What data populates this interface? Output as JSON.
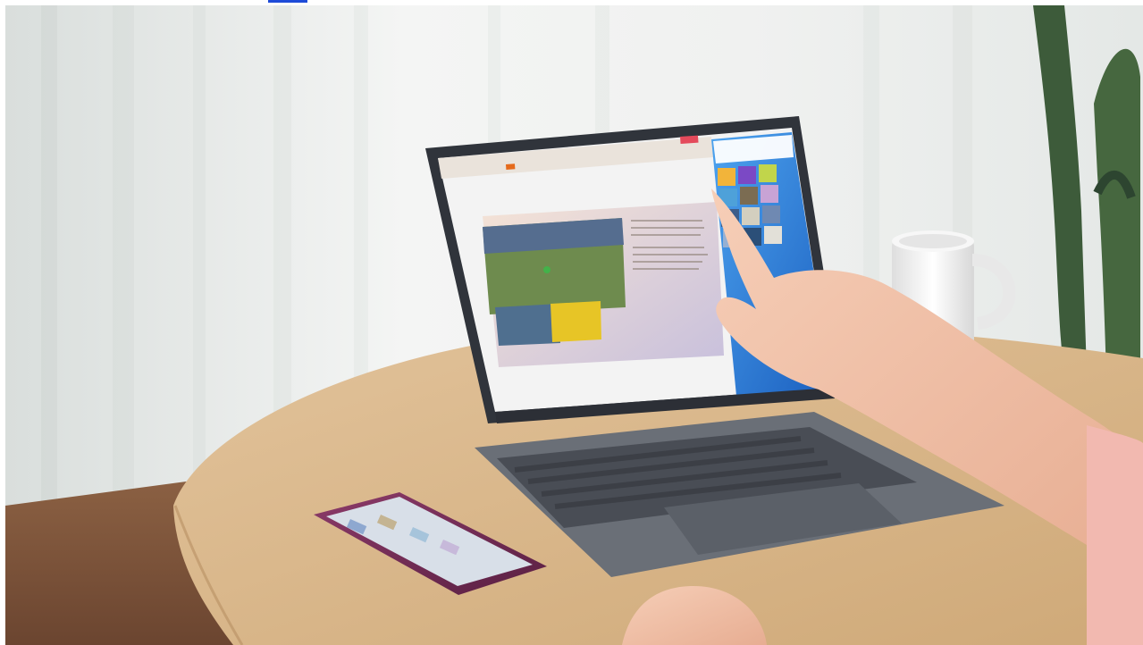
{
  "page": {
    "link_color": "#1e4bd8"
  },
  "scene": {
    "subject": "laptop-multi-screen-collaboration-photo",
    "colors": {
      "curtain": "#eef0ef",
      "table": "#dcb98e",
      "laptop_body": "#5b5f66",
      "screen_blue": "#2a78d6",
      "mug": "#f4f4f4",
      "cactus": "#3d5b3a",
      "phone": "#7a2f5b",
      "skin": "#f1c2a8",
      "sleeve": "#f2b9b0"
    }
  },
  "laptop_screen": {
    "slide": {
      "visible": true
    },
    "phone_window": {
      "visible": true
    }
  }
}
